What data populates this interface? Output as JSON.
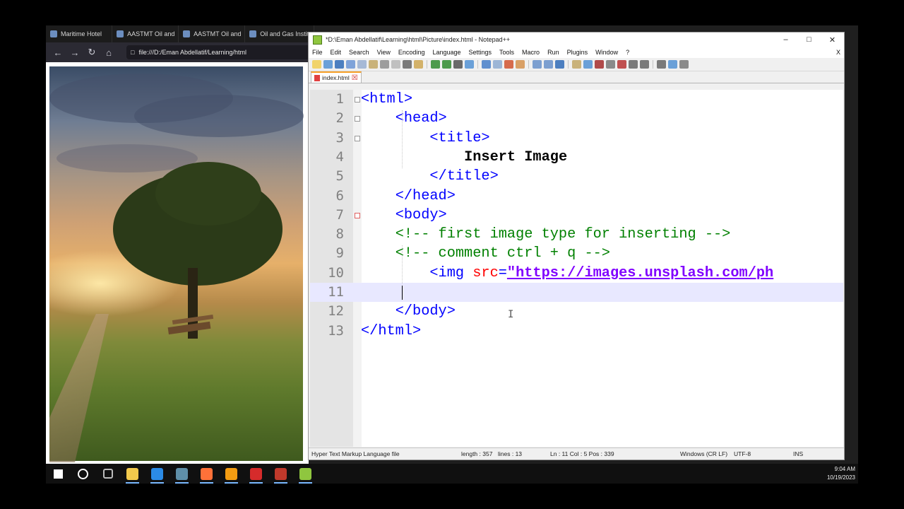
{
  "browser": {
    "tabs": [
      {
        "label": "Maritime Hotel",
        "icon": "globe-icon"
      },
      {
        "label": "AASTMT Oil and",
        "icon": "globe-icon"
      },
      {
        "label": "AASTMT Oil and",
        "icon": "globe-icon"
      },
      {
        "label": "Oil and Gas Institute",
        "icon": "globe-icon"
      }
    ],
    "address": "file:///D:/Eman Abdellatif/Learning/html"
  },
  "notepad": {
    "title": "*D:\\Eman Abdellatif\\Learning\\html\\Picture\\index.html - Notepad++",
    "menu": [
      "File",
      "Edit",
      "Search",
      "View",
      "Encoding",
      "Language",
      "Settings",
      "Tools",
      "Macro",
      "Run",
      "Plugins",
      "Window",
      "?"
    ],
    "menu_close": "X",
    "tab_label": "index.html",
    "lines": [
      {
        "n": "1",
        "indent": "",
        "parts": [
          {
            "t": "tag",
            "v": "<html>"
          }
        ]
      },
      {
        "n": "2",
        "indent": "    ",
        "parts": [
          {
            "t": "tag",
            "v": "<head>"
          }
        ]
      },
      {
        "n": "3",
        "indent": "        ",
        "parts": [
          {
            "t": "tag",
            "v": "<title>"
          }
        ]
      },
      {
        "n": "4",
        "indent": "            ",
        "parts": [
          {
            "t": "txt",
            "v": "Insert Image"
          }
        ]
      },
      {
        "n": "5",
        "indent": "        ",
        "parts": [
          {
            "t": "tag",
            "v": "</title>"
          }
        ]
      },
      {
        "n": "6",
        "indent": "    ",
        "parts": [
          {
            "t": "tag",
            "v": "</head>"
          }
        ]
      },
      {
        "n": "7",
        "indent": "    ",
        "parts": [
          {
            "t": "tag",
            "v": "<body>"
          }
        ]
      },
      {
        "n": "8",
        "indent": "    ",
        "parts": [
          {
            "t": "cmt",
            "v": "<!-- first image type for inserting -->"
          }
        ]
      },
      {
        "n": "9",
        "indent": "    ",
        "parts": [
          {
            "t": "cmt",
            "v": "<!-- comment ctrl + q -->"
          }
        ]
      },
      {
        "n": "10",
        "indent": "        ",
        "parts": [
          {
            "t": "tag",
            "v": "<img "
          },
          {
            "t": "attr",
            "v": "src"
          },
          {
            "t": "tag",
            "v": "="
          },
          {
            "t": "val",
            "v": "\"https://images.unsplash.com/ph"
          }
        ]
      },
      {
        "n": "11",
        "indent": "    ",
        "parts": []
      },
      {
        "n": "12",
        "indent": "    ",
        "parts": [
          {
            "t": "tag",
            "v": "</body>"
          }
        ]
      },
      {
        "n": "13",
        "indent": "",
        "parts": [
          {
            "t": "tag",
            "v": "</html>"
          }
        ]
      }
    ],
    "status": {
      "filetype": "Hyper Text Markup Language file",
      "length": "length : 357",
      "lines": "lines : 13",
      "position": "Ln : 11    Col : 5    Pos : 339",
      "eol": "Windows (CR LF)",
      "encoding": "UTF-8",
      "mode": "INS"
    }
  },
  "taskbar": {
    "apps": [
      "windows-start-icon",
      "search-icon",
      "task-view-icon",
      "file-explorer-icon",
      "edge-icon",
      "calculator-icon",
      "firefox-icon",
      "sublime-icon",
      "acrobat-icon",
      "app-icon",
      "notepad-plus-plus-icon"
    ],
    "time": "9:04 AM",
    "date": "10/19/2023"
  },
  "colors": {
    "tag": "#0000ff",
    "comment": "#008000",
    "attribute": "#ff0000",
    "value": "#8000ff",
    "caret_line": "#e8e8ff"
  }
}
